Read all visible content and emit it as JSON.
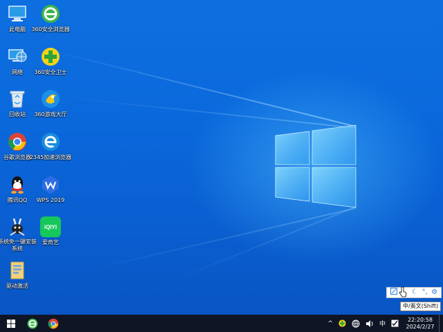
{
  "desktop": {
    "icons": [
      {
        "label": "此电脑",
        "icon": "computer-icon"
      },
      {
        "label": "360安全浏览器",
        "icon": "360-browser-icon"
      },
      {
        "label": "网络",
        "icon": "network-icon"
      },
      {
        "label": "360安全卫士",
        "icon": "360-guard-icon"
      },
      {
        "label": "回收站",
        "icon": "recycle-bin-icon"
      },
      {
        "label": "360游戏大厅",
        "icon": "360-game-hall-icon"
      },
      {
        "label": "谷歌浏览器",
        "icon": "chrome-icon"
      },
      {
        "label": "2345加速浏览器",
        "icon": "2345-browser-icon"
      },
      {
        "label": "腾讯QQ",
        "icon": "qq-icon"
      },
      {
        "label": "WPS 2019",
        "icon": "wps-icon"
      },
      {
        "label": "系统免一键安装系统",
        "icon": "system-installer-icon"
      },
      {
        "label": "爱奇艺",
        "icon": "iqiyi-icon"
      },
      {
        "label": "驱动激活",
        "icon": "driver-activation-icon"
      }
    ],
    "iqiyi_logo_text": "iQIYI"
  },
  "ime": {
    "toolbar_icons": [
      "ime-mode-icon",
      "cursor-icon",
      "moon-icon",
      "punctuation-icon",
      "gear-icon"
    ],
    "tooltip": "中/英文(Shift)"
  },
  "taskbar": {
    "pinned": [
      "start-icon",
      "360-browser-icon",
      "chrome-icon"
    ],
    "tray": {
      "chevron": "^",
      "ime_lang": "中",
      "icons": [
        "360-guard-tray-icon",
        "network-tray-icon",
        "volume-icon",
        "notification-icon"
      ]
    },
    "clock": {
      "time": "22:20:58",
      "date": "2024/2/27"
    }
  },
  "colors": {
    "accent": "#0a68db",
    "taskbar": "#0f1524",
    "logo": "#6fd0ff"
  }
}
